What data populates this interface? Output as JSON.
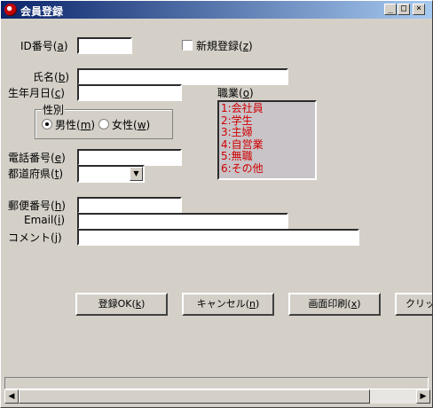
{
  "window": {
    "title": "会員登録"
  },
  "titlebar_buttons": {
    "minimize": "_",
    "maximize": "□",
    "close": "×"
  },
  "form": {
    "id_label": "ID番号(",
    "id_key": "a",
    "new_label": "新規登録(",
    "new_key": "z",
    "name_label": "氏名(",
    "name_key": "b",
    "birth_label": "生年月日(",
    "birth_key": "c",
    "gender_group_label": "性別",
    "male_label": "男性(",
    "male_key": "m",
    "female_label": "女性(",
    "female_key": "w",
    "job_label": "職業(",
    "job_key": "o",
    "phone_label": "電話番号(",
    "phone_key": "e",
    "pref_label": "都道府県(",
    "pref_key": "t",
    "zip_label": "郵便番号(",
    "zip_key": "h",
    "email_label": "Email(",
    "email_key": "i",
    "comment_label": "コメント(",
    "comment_key": "j",
    "close_paren": ")"
  },
  "occupations": [
    "1:会社員",
    "2:学生",
    "3:主婦",
    "4:自営業",
    "5:無職",
    "6:その他"
  ],
  "buttons": {
    "ok": "登録OK(",
    "ok_key": "k",
    "cancel": "キャンセル(",
    "cancel_key": "n",
    "print": "画面印刷(",
    "print_key": "x",
    "clear": "クリッ"
  },
  "scrollbar": {
    "left": "◀",
    "right": "▶"
  },
  "colors": {
    "list_text": "#d00000",
    "titlebar": "#0a246a"
  }
}
